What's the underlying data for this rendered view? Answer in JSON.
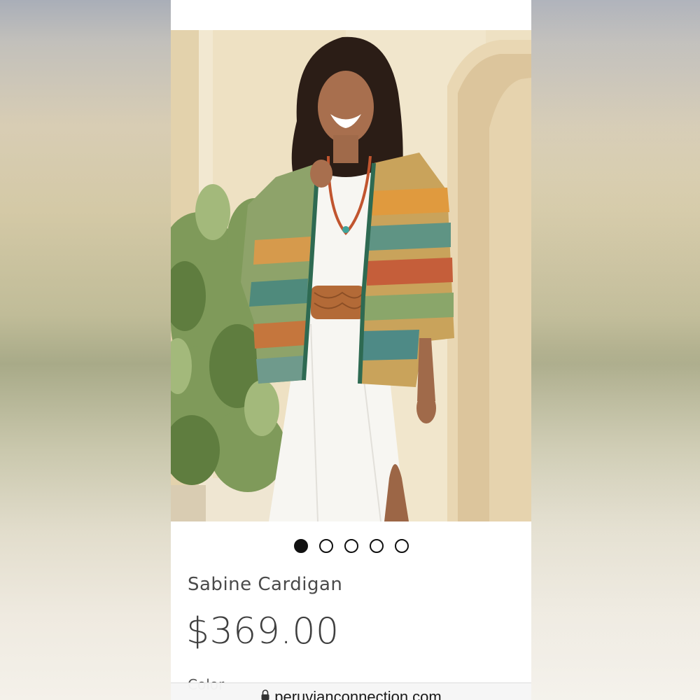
{
  "product": {
    "title": "Sabine Cardigan",
    "price": "$369.00",
    "color_label": "Color"
  },
  "carousel": {
    "total": 5,
    "active_index": 0
  },
  "browser": {
    "url": "peruvianconnection.com"
  },
  "icons": {
    "lock": "lock-icon"
  },
  "colors": {
    "text_primary": "#4a4a4a",
    "dot_active": "#111111",
    "background": "#ffffff"
  }
}
